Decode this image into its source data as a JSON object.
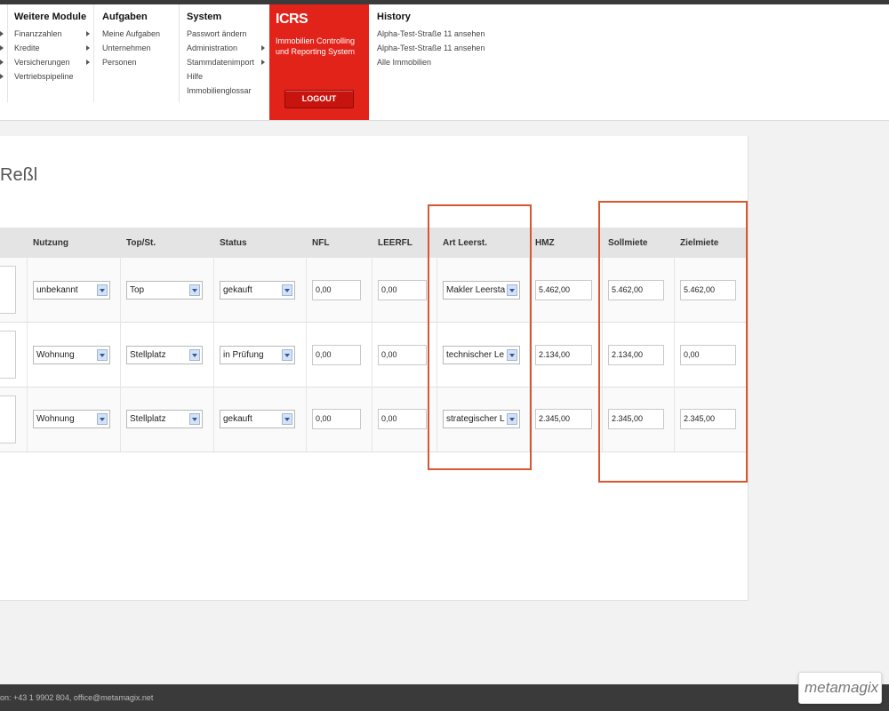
{
  "menu": {
    "weitere": {
      "head": "Weitere Module",
      "items": [
        "Finanzzahlen",
        "Kredite",
        "Versicherungen",
        "Vertriebspipeline"
      ]
    },
    "aufgaben": {
      "head": "Aufgaben",
      "items": [
        "Meine Aufgaben",
        "Unternehmen",
        "Personen"
      ]
    },
    "system": {
      "head": "System",
      "items": [
        "Passwort ändern",
        "Administration",
        "Stammdatenimport",
        "Hilfe",
        "Immobilienglossar"
      ]
    },
    "icrs": {
      "title": "ICRS",
      "subtitle": "Immobilien Controlling und Reporting System",
      "logout": "LOGOUT"
    },
    "history": {
      "head": "History",
      "items": [
        "Alpha-Test-Straße 11 ansehen",
        "Alpha-Test-Straße 11 ansehen",
        "Alle Immobilien"
      ]
    }
  },
  "page": {
    "title": "Reßl"
  },
  "table": {
    "headers": {
      "nutzung": "Nutzung",
      "top": "Top/St.",
      "status": "Status",
      "nfl": "NFL",
      "leerfl": "LEERFL",
      "art": "Art Leerst.",
      "hmz": "HMZ",
      "soll": "Sollmiete",
      "ziel": "Zielmiete"
    },
    "rows": [
      {
        "nutzung": "unbekannt",
        "top": "Top",
        "status": "gekauft",
        "nfl": "0,00",
        "leerfl": "0,00",
        "art": "Makler Leersta",
        "hmz": "5.462,00",
        "soll": "5.462,00",
        "ziel": "5.462,00"
      },
      {
        "nutzung": "Wohnung",
        "top": "Stellplatz",
        "status": "in Prüfung",
        "nfl": "0,00",
        "leerfl": "0,00",
        "art": "technischer Le",
        "hmz": "2.134,00",
        "soll": "2.134,00",
        "ziel": "0,00"
      },
      {
        "nutzung": "Wohnung",
        "top": "Stellplatz",
        "status": "gekauft",
        "nfl": "0,00",
        "leerfl": "0,00",
        "art": "strategischer L",
        "hmz": "2.345,00",
        "soll": "2.345,00",
        "ziel": "2.345,00"
      }
    ]
  },
  "footer": {
    "contact": "on: +43 1 9902 804, office@metamagix.net"
  },
  "logo": {
    "text": "metamagix"
  },
  "colors": {
    "accent": "#e2231a",
    "highlight": "#d9572e",
    "dark": "#3a3a3a"
  }
}
